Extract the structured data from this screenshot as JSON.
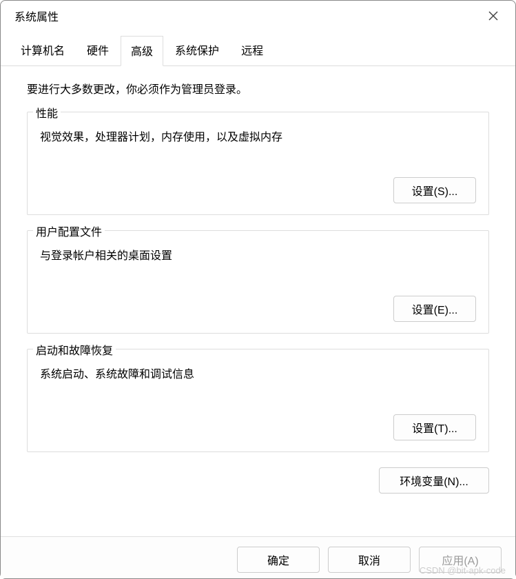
{
  "window": {
    "title": "系统属性"
  },
  "tabs": {
    "computer_name": "计算机名",
    "hardware": "硬件",
    "advanced": "高级",
    "system_protection": "系统保护",
    "remote": "远程"
  },
  "content": {
    "intro": "要进行大多数更改，你必须作为管理员登录。",
    "performance": {
      "title": "性能",
      "desc": "视觉效果，处理器计划，内存使用，以及虚拟内存",
      "button": "设置(S)..."
    },
    "userprofiles": {
      "title": "用户配置文件",
      "desc": "与登录帐户相关的桌面设置",
      "button": "设置(E)..."
    },
    "startup": {
      "title": "启动和故障恢复",
      "desc": "系统启动、系统故障和调试信息",
      "button": "设置(T)..."
    },
    "env_button": "环境变量(N)..."
  },
  "footer": {
    "ok": "确定",
    "cancel": "取消",
    "apply": "应用(A)"
  },
  "watermark": "CSDN @bit-apk-code"
}
